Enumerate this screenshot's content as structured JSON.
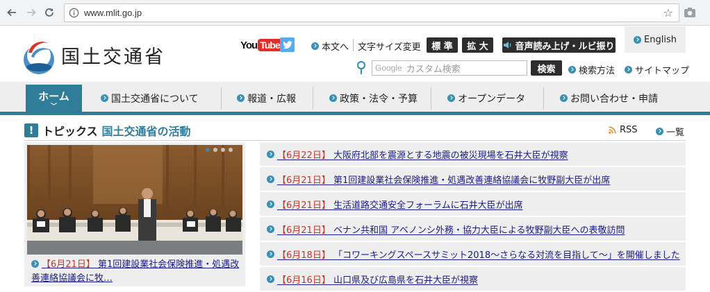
{
  "browser": {
    "url": "www.mlit.go.jp"
  },
  "header": {
    "logo_text": "国土交通省",
    "social": {
      "youtube_you": "You",
      "youtube_tube": "Tube"
    },
    "links": {
      "skip": "本文へ",
      "font_size_label": "文字サイズ変更",
      "standard": "標 準",
      "enlarge": "拡 大",
      "read_aloud": "音声読み上げ・ルビ振り",
      "english": "English",
      "search_help": "検索方法",
      "sitemap": "サイトマップ"
    },
    "search": {
      "google_label": "Google",
      "placeholder": "カスタム検索",
      "button": "検索"
    }
  },
  "nav": {
    "home": "ホーム",
    "items": [
      {
        "label": "国土交通省について"
      },
      {
        "label": "報道・広報"
      },
      {
        "label": "政策・法令・予算"
      },
      {
        "label": "オープンデータ"
      },
      {
        "label": "お問い合わせ・申請"
      }
    ]
  },
  "topics": {
    "title": "トピックス",
    "subtitle": "国土交通省の活動",
    "rss": "RSS",
    "list": "一覧",
    "featured": {
      "date": "【6月21日】",
      "text": "第1回建設業社会保険推進・処遇改善連絡協議会に牧…"
    },
    "news": [
      {
        "date": "【6月22日】",
        "text": "大阪府北部を震源とする地震の被災現場を石井大臣が視察"
      },
      {
        "date": "【6月21日】",
        "text": "第1回建設業社会保険推進・処遇改善連絡協議会に牧野副大臣が出席"
      },
      {
        "date": "【6月21日】",
        "text": "生活道路交通安全フォーラムに石井大臣が出席"
      },
      {
        "date": "【6月21日】",
        "text": "ベナン共和国 アベノンシ外務・協力大臣による牧野副大臣への表敬訪問"
      },
      {
        "date": "【6月18日】",
        "text": "「コワーキングスペースサミット2018～さらなる対流を目指して～」を開催しました"
      },
      {
        "date": "【6月16日】",
        "text": "山口県及び広島県を石井大臣が視察"
      }
    ]
  },
  "colors": {
    "accent": "#2f7d99",
    "nav_bg": "#eeeeee",
    "link": "#1a1a8a",
    "youtube_red": "#e52d27",
    "twitter_blue": "#55acee"
  }
}
